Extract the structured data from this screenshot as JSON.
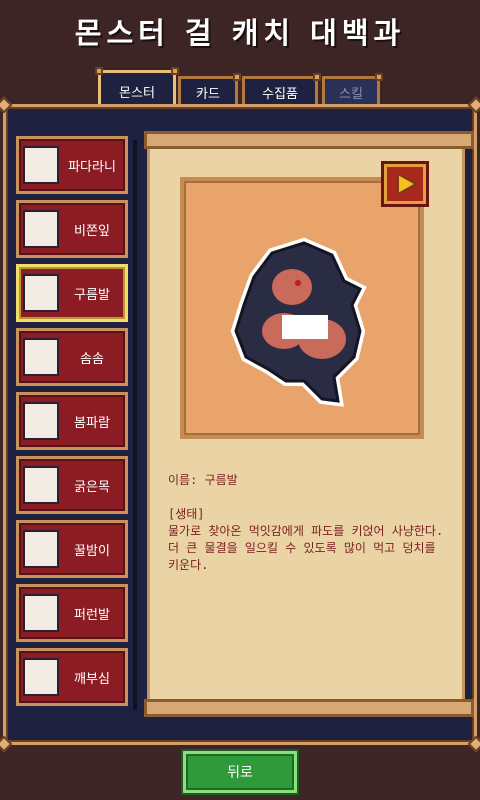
{
  "title": "몬스터 걸 캐치 대백과",
  "tabs": [
    {
      "label": "몬스터",
      "state": "active"
    },
    {
      "label": "카드",
      "state": "normal"
    },
    {
      "label": "수집품",
      "state": "normal"
    },
    {
      "label": "스킬",
      "state": "disabled"
    }
  ],
  "monsters": [
    {
      "name": "파다라니",
      "icon": "redhead-girl-portrait",
      "selected": false
    },
    {
      "name": "비쫀잎",
      "icon": "leaf-girl-portrait",
      "selected": false
    },
    {
      "name": "구름발",
      "icon": "darkhair-girl-portrait",
      "selected": true
    },
    {
      "name": "솜솜",
      "icon": "whitehair-girl-portrait",
      "selected": false
    },
    {
      "name": "봄파람",
      "icon": "bunny-girl-portrait",
      "selected": false
    },
    {
      "name": "굵은목",
      "icon": "brown-girl-portrait",
      "selected": false
    },
    {
      "name": "꿀밤이",
      "icon": "striped-girl-portrait",
      "selected": false
    },
    {
      "name": "퍼런발",
      "icon": "blue-girl-portrait",
      "selected": false
    },
    {
      "name": "깨부심",
      "icon": "horned-girl-portrait",
      "selected": false
    }
  ],
  "detail": {
    "name_line": "이름: 구름발",
    "section_label": "[생태]",
    "description": "물가로 찾아온 먹잇감에게 파도를 키얹어 사냥한다. 더 큰 물결을 일으킬 수 있도록 많이 먹고 덩치를 키운다.",
    "play_icon": "play-icon",
    "portrait_icon": "cloudfoot-monster-art"
  },
  "back_label": "뒤로",
  "colors": {
    "accent_red": "#8c1c24",
    "gold_border": "#d2a06a",
    "back_green": "#2f9a3a",
    "panel_bg": "#1e2240"
  }
}
